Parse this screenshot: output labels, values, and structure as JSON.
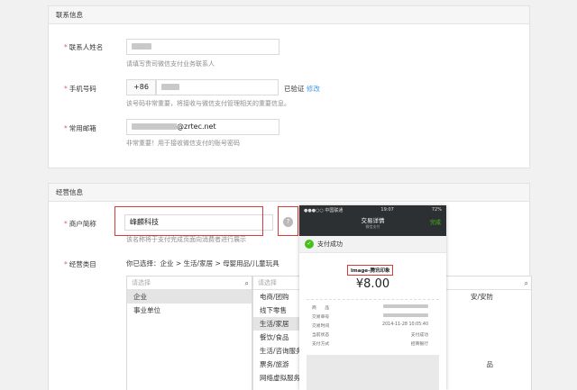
{
  "contact": {
    "section_title": "联系信息",
    "name_label": "联系人姓名",
    "name_hint": "请填写贵司微信支付业务联系人",
    "phone_label": "手机号码",
    "phone_prefix": "+86",
    "phone_status": "已验证",
    "phone_edit": "修改",
    "phone_hint": "该号码非常重要，将接收与微信支付管理相关的重要信息。",
    "email_label": "常用邮箱",
    "email_suffix": "@zrtec.net",
    "email_hint": "非常重要！用于接收微信支付的账号密码"
  },
  "business": {
    "section_title": "经营信息",
    "short_name_label": "商户简称",
    "short_name_value": "峰麟科技",
    "short_name_hint": "该名称将于支付完成页面向消费者进行展示",
    "category_label": "经营类目",
    "category_path": "你已选择：企业 > 生活/家居 > 母婴用品/儿童玩具",
    "search_placeholder": "请选择",
    "list1": [
      "企业",
      "事业单位"
    ],
    "list1_selected": 0,
    "list2": [
      "电商/团购",
      "线下零售",
      "生活/家居",
      "餐饮/食品",
      "生活/咨询服务",
      "票务/旅游",
      "网络虚拟服务"
    ],
    "list2_selected": 2,
    "list3_partial": [
      "安/安防",
      "",
      "",
      "",
      "",
      "品",
      ""
    ]
  },
  "receipt": {
    "carrier": "●●●○○ 中国联通",
    "time": "19:07",
    "battery": "72%",
    "title": "交易详情",
    "subtitle": "微信支付",
    "done": "完成",
    "success": "支付成功",
    "merchant_label": "Image-腾讯印象",
    "amount": "¥8.00",
    "rows": [
      {
        "k": "商　　品",
        "v": ""
      },
      {
        "k": "交易单号",
        "v": ""
      },
      {
        "k": "交易时间",
        "v": "2014-11-28 10:05:40"
      },
      {
        "k": "当前状态",
        "v": "支付成功"
      },
      {
        "k": "支付方式",
        "v": "招商银行"
      }
    ]
  },
  "colors": {
    "required_star": "#e15f63",
    "link": "#459ae9",
    "highlight": "#d83b3b",
    "wechat_green": "#45c01a"
  }
}
